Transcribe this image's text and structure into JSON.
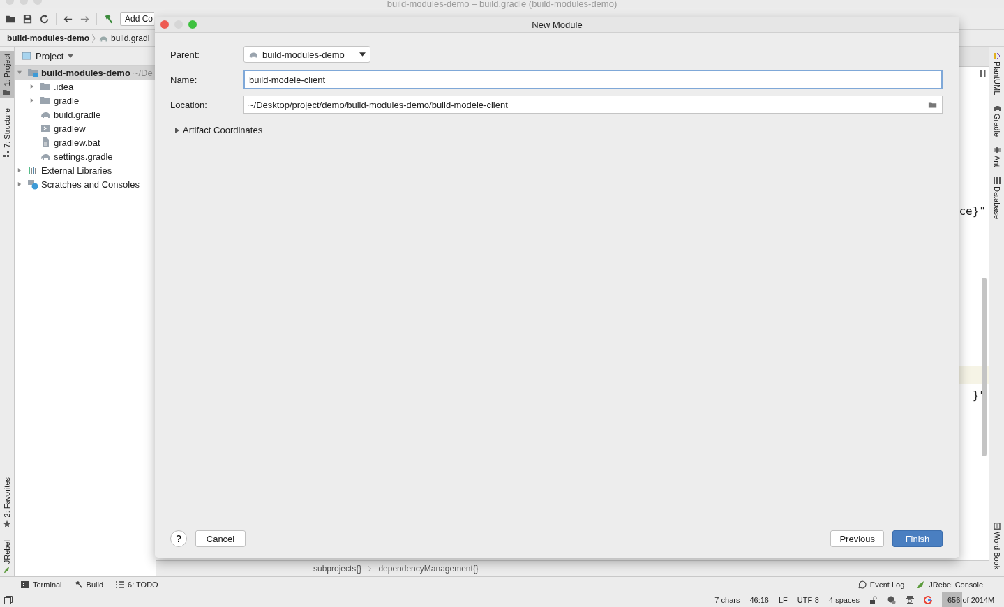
{
  "window": {
    "title": "build-modules-demo – build.gradle (build-modules-demo)"
  },
  "toolbar": {
    "run_config": "Add Co"
  },
  "breadcrumb": [
    "build-modules-demo",
    "build.gradl"
  ],
  "left_stripe_top": [
    {
      "label": "1: Project",
      "selected": true
    },
    {
      "label": "7: Structure",
      "selected": false
    }
  ],
  "left_stripe_bottom": [
    {
      "label": "2: Favorites",
      "selected": false
    },
    {
      "label": "JRebel",
      "selected": false
    }
  ],
  "project_panel": {
    "title": "Project",
    "tree": [
      {
        "label": "build-modules-demo",
        "suffix": "~/De",
        "kind": "module",
        "expanded": true,
        "selected": true,
        "children": [
          {
            "label": ".idea",
            "kind": "folder",
            "expanded": false,
            "selected": false
          },
          {
            "label": "gradle",
            "kind": "folder",
            "expanded": false,
            "selected": false
          },
          {
            "label": "build.gradle",
            "kind": "gradle",
            "selected": false
          },
          {
            "label": "gradlew",
            "kind": "script",
            "selected": false
          },
          {
            "label": "gradlew.bat",
            "kind": "text",
            "selected": false
          },
          {
            "label": "settings.gradle",
            "kind": "gradle",
            "selected": false
          }
        ]
      },
      {
        "label": "External Libraries",
        "kind": "libraries",
        "expanded": false,
        "selected": false
      },
      {
        "label": "Scratches and Consoles",
        "kind": "scratches",
        "expanded": false,
        "selected": false
      }
    ]
  },
  "editor": {
    "code_lines": [
      "ce}\"",
      "}\""
    ],
    "breadcrumb": [
      "subprojects{}",
      "dependencyManagement{}"
    ]
  },
  "right_stripe_top": [
    "PlantUML",
    "Gradle",
    "Ant",
    "Database"
  ],
  "right_stripe_bottom": [
    "Word Book"
  ],
  "tool_windows": {
    "left": [
      "Terminal",
      "Build",
      "6: TODO"
    ],
    "right": [
      "Event Log",
      "JRebel Console"
    ]
  },
  "status_bar": {
    "items": [
      "7 chars",
      "46:16",
      "LF",
      "UTF-8",
      "4 spaces"
    ],
    "memory": {
      "text": "656 of 2014M",
      "level": 0.33
    }
  },
  "dialog": {
    "title": "New Module",
    "parent": {
      "label": "Parent:",
      "value": "build-modules-demo"
    },
    "name": {
      "label": "Name:",
      "value": "build-modele-client",
      "focused": true
    },
    "location": {
      "label": "Location:",
      "value": "~/Desktop/project/demo/build-modules-demo/build-modele-client"
    },
    "artifact": {
      "label": "Artifact Coordinates",
      "expanded": false
    },
    "help": "?",
    "left_buttons": [
      {
        "label": "Cancel",
        "default": false
      }
    ],
    "right_buttons": [
      {
        "label": "Previous",
        "default": false
      },
      {
        "label": "Finish",
        "default": true
      }
    ]
  }
}
